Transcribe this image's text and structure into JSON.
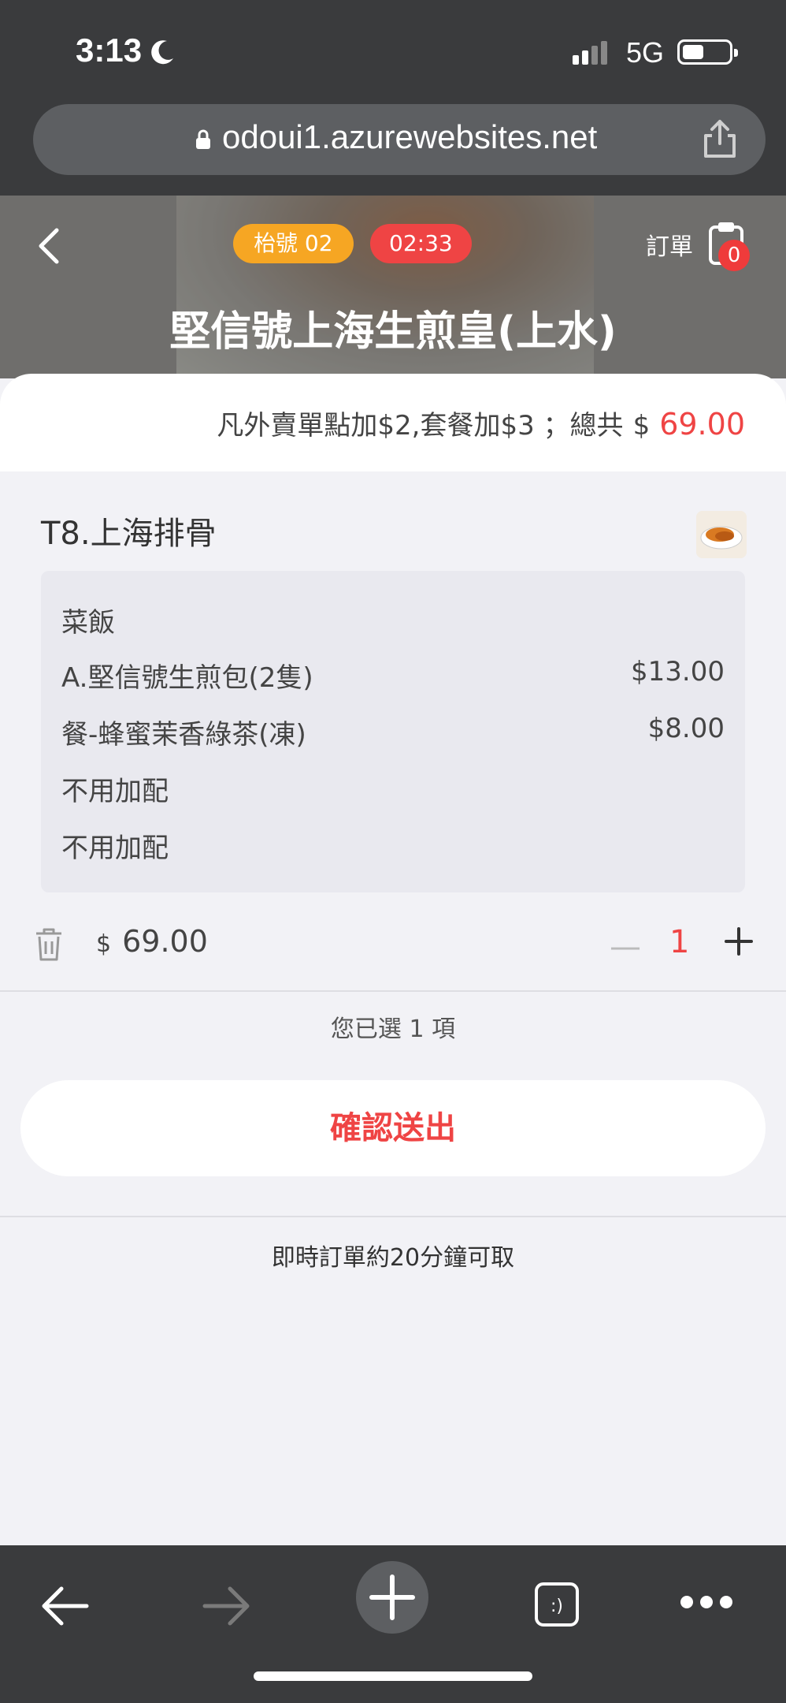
{
  "status_bar": {
    "time": "3:13",
    "network": "5G"
  },
  "browser": {
    "url": "odoui1.azurewebsites.net"
  },
  "header": {
    "number_badge": "枱號 02",
    "timer_badge": "02:33",
    "order_label": "訂單",
    "cart_count": "0",
    "title": "堅信號上海生煎皇(上水)"
  },
  "summary": {
    "note": "凡外賣單點加$2,套餐加$3 ；總共",
    "currency": "$",
    "total": "69.00"
  },
  "item": {
    "name": "T8.上海排骨",
    "options": [
      {
        "label": "菜飯",
        "price": ""
      },
      {
        "label": "A.堅信號生煎包(2隻)",
        "price": "$13.00"
      },
      {
        "label": "餐-蜂蜜茉香綠茶(凍)",
        "price": "$8.00"
      },
      {
        "label": "不用加配",
        "price": ""
      },
      {
        "label": "不用加配",
        "price": ""
      }
    ],
    "currency": "$",
    "price": "69.00",
    "quantity": "1"
  },
  "selected_count": "您已選 1 項",
  "confirm_label": "確認送出",
  "footer_note": "即時訂單約20分鐘可取",
  "colors": {
    "accent_red": "#ef4444",
    "badge_orange": "#f6a623"
  }
}
